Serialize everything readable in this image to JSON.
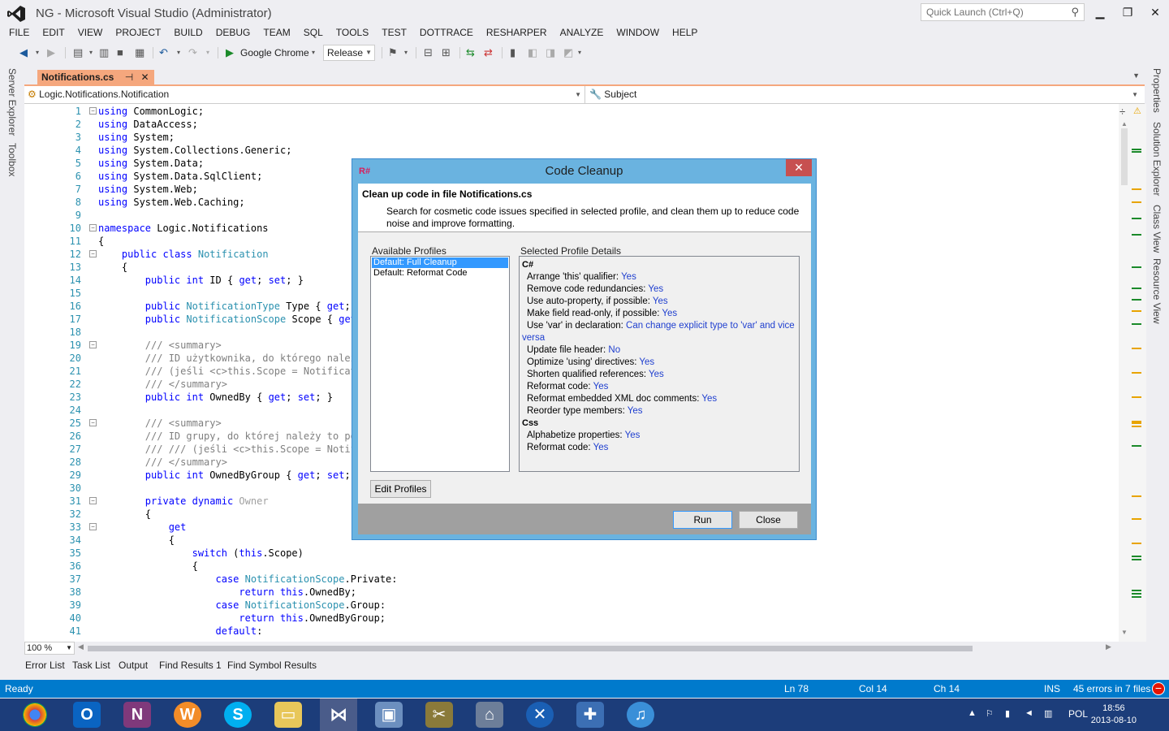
{
  "window": {
    "title": "NG - Microsoft Visual Studio (Administrator)",
    "quick_launch_placeholder": "Quick Launch (Ctrl+Q)"
  },
  "menu": [
    "FILE",
    "EDIT",
    "VIEW",
    "PROJECT",
    "BUILD",
    "DEBUG",
    "TEAM",
    "SQL",
    "TOOLS",
    "TEST",
    "DOTTRACE",
    "RESHARPER",
    "ANALYZE",
    "WINDOW",
    "HELP"
  ],
  "toolbar": {
    "run_target": "Google Chrome",
    "configuration": "Release"
  },
  "left_panels": [
    "Server Explorer",
    "Toolbox"
  ],
  "right_panels": [
    "Properties",
    "Solution Explorer",
    "Class View",
    "Resource View"
  ],
  "doc_tab": {
    "name": "Notifications.cs",
    "pin": "⊣",
    "close": "✕"
  },
  "navbar": {
    "type": "Logic.Notifications.Notification",
    "member": "Subject"
  },
  "editor": {
    "zoom": "100 %",
    "lines": [
      {
        "n": "1",
        "t": "using CommonLogic;"
      },
      {
        "n": "2",
        "t": "using DataAccess;"
      },
      {
        "n": "3",
        "t": "using System;"
      },
      {
        "n": "4",
        "t": "using System.Collections.Generic;"
      },
      {
        "n": "5",
        "t": "using System.Data;"
      },
      {
        "n": "6",
        "t": "using System.Data.SqlClient;"
      },
      {
        "n": "7",
        "t": "using System.Web;"
      },
      {
        "n": "8",
        "t": "using System.Web.Caching;"
      },
      {
        "n": "9",
        "t": ""
      },
      {
        "n": "10",
        "t": "namespace Logic.Notifications"
      },
      {
        "n": "11",
        "t": "{"
      },
      {
        "n": "12",
        "t": "    public class Notification"
      },
      {
        "n": "13",
        "t": "    {"
      },
      {
        "n": "14",
        "t": "        public int ID { get; set; }"
      },
      {
        "n": "15",
        "t": ""
      },
      {
        "n": "16",
        "t": "        public NotificationType Type { get; s"
      },
      {
        "n": "17",
        "t": "        public NotificationScope Scope { get;"
      },
      {
        "n": "18",
        "t": ""
      },
      {
        "n": "19",
        "t": "        /// <summary>"
      },
      {
        "n": "20",
        "t": "        /// ID użytkownika, do którego należy"
      },
      {
        "n": "21",
        "t": "        /// (jeśli <c>this.Scope = Notificati"
      },
      {
        "n": "22",
        "t": "        /// </summary>"
      },
      {
        "n": "23",
        "t": "        public int OwnedBy { get; set; }"
      },
      {
        "n": "24",
        "t": ""
      },
      {
        "n": "25",
        "t": "        /// <summary>"
      },
      {
        "n": "26",
        "t": "        /// ID grupy, do której należy to pow"
      },
      {
        "n": "27",
        "t": "        /// /// (jeśli <c>this.Scope = Notifi"
      },
      {
        "n": "28",
        "t": "        /// </summary>"
      },
      {
        "n": "29",
        "t": "        public int OwnedByGroup { get; set; }"
      },
      {
        "n": "30",
        "t": ""
      },
      {
        "n": "31",
        "t": "        private dynamic Owner"
      },
      {
        "n": "32",
        "t": "        {"
      },
      {
        "n": "33",
        "t": "            get"
      },
      {
        "n": "34",
        "t": "            {"
      },
      {
        "n": "35",
        "t": "                switch (this.Scope)"
      },
      {
        "n": "36",
        "t": "                {"
      },
      {
        "n": "37",
        "t": "                    case NotificationScope.Private:"
      },
      {
        "n": "38",
        "t": "                        return this.OwnedBy;"
      },
      {
        "n": "39",
        "t": "                    case NotificationScope.Group:"
      },
      {
        "n": "40",
        "t": "                        return this.OwnedByGroup;"
      },
      {
        "n": "41",
        "t": "                    default:"
      }
    ]
  },
  "bottom_tabs": [
    "Error List",
    "Task List",
    "Output",
    "Find Results 1",
    "Find Symbol Results"
  ],
  "status": {
    "ready": "Ready",
    "ln": "Ln 78",
    "col": "Col 14",
    "ch": "Ch 14",
    "ins": "INS",
    "errors": "45 errors in 7 files"
  },
  "taskbar": {
    "lang": "POL",
    "time": "18:56",
    "date": "2013-08-10"
  },
  "dialog": {
    "title": "Code Cleanup",
    "logo": "R#",
    "close": "✕",
    "heading": "Clean up code in file Notifications.cs",
    "description": "Search for cosmetic code issues specified in selected profile, and clean them up to reduce code noise and improve formatting.",
    "profiles_label": "Available Profiles",
    "profiles": [
      "Default: Full Cleanup",
      "Default: Reformat Code"
    ],
    "details_label": "Selected Profile Details",
    "groups": [
      {
        "name": "C#",
        "items": [
          {
            "label": "Arrange 'this' qualifier:",
            "value": "Yes"
          },
          {
            "label": "Remove code redundancies:",
            "value": "Yes"
          },
          {
            "label": "Use auto-property, if possible:",
            "value": "Yes"
          },
          {
            "label": "Make field read-only, if possible:",
            "value": "Yes"
          },
          {
            "label": "Use 'var' in declaration:",
            "value": "Can change explicit type to 'var' and vice versa"
          },
          {
            "label": "Update file header:",
            "value": "No"
          },
          {
            "label": "Optimize 'using' directives:",
            "value": "Yes"
          },
          {
            "label": "Shorten qualified references:",
            "value": "Yes"
          },
          {
            "label": "Reformat code:",
            "value": "Yes"
          },
          {
            "label": "Reformat embedded XML doc comments:",
            "value": "Yes"
          },
          {
            "label": "Reorder type members:",
            "value": "Yes"
          }
        ]
      },
      {
        "name": "Css",
        "items": [
          {
            "label": "Alphabetize properties:",
            "value": "Yes"
          },
          {
            "label": "Reformat code:",
            "value": "Yes"
          }
        ]
      }
    ],
    "edit_profiles": "Edit Profiles",
    "run": "Run",
    "close_label": "Close"
  }
}
